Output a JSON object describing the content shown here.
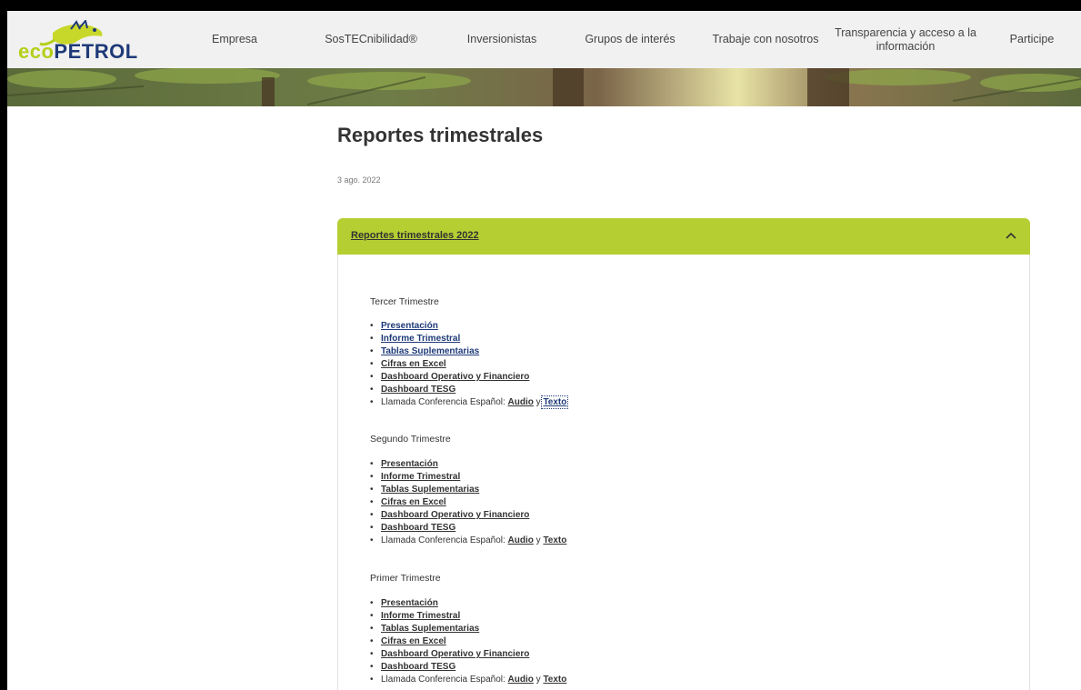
{
  "header": {
    "logo": {
      "part1": "eco",
      "part2": "PETROL"
    },
    "nav": [
      "Empresa",
      "SosTECnibilidad®",
      "Inversionistas",
      "Grupos de interés",
      "Trabaje con nosotros",
      "Transparencia y acceso a la información",
      "Participe"
    ]
  },
  "page": {
    "title": "Reportes trimestrales",
    "date": "3 ago. 2022"
  },
  "accordion": {
    "title": "Reportes trimestrales 2022",
    "expanded": true,
    "sections": [
      {
        "label": "Tercer Trimestre",
        "links": [
          "Presentación",
          "Informe Trimestral",
          "Tablas Suplementarias",
          "Cifras en Excel",
          "Dashboard Operativo y Financiero",
          "Dashboard TESG"
        ],
        "call": {
          "prefix": "Llamada Conferencia Español:",
          "audio": "Audio",
          "sep": "y",
          "text": "Texto"
        }
      },
      {
        "label": "Segundo Trimestre",
        "links": [
          "Presentación",
          "Informe Trimestral",
          "Tablas Suplementarias",
          "Cifras en Excel",
          "Dashboard Operativo y Financiero",
          "Dashboard TESG"
        ],
        "call": {
          "prefix": "Llamada Conferencia Español:",
          "audio": "Audio",
          "sep": "y",
          "text": "Texto"
        }
      },
      {
        "label": "Primer Trimestre",
        "links": [
          "Presentación",
          "Informe Trimestral",
          "Tablas Suplementarias",
          "Cifras en Excel",
          "Dashboard Operativo y Financiero",
          "Dashboard TESG"
        ],
        "call": {
          "prefix": "Llamada Conferencia Español:",
          "audio": "Audio",
          "sep": "y",
          "text": "Texto"
        }
      }
    ]
  },
  "colors": {
    "brand_green": "#b5cf33",
    "brand_blue": "#1e3a78",
    "text": "#333333"
  }
}
